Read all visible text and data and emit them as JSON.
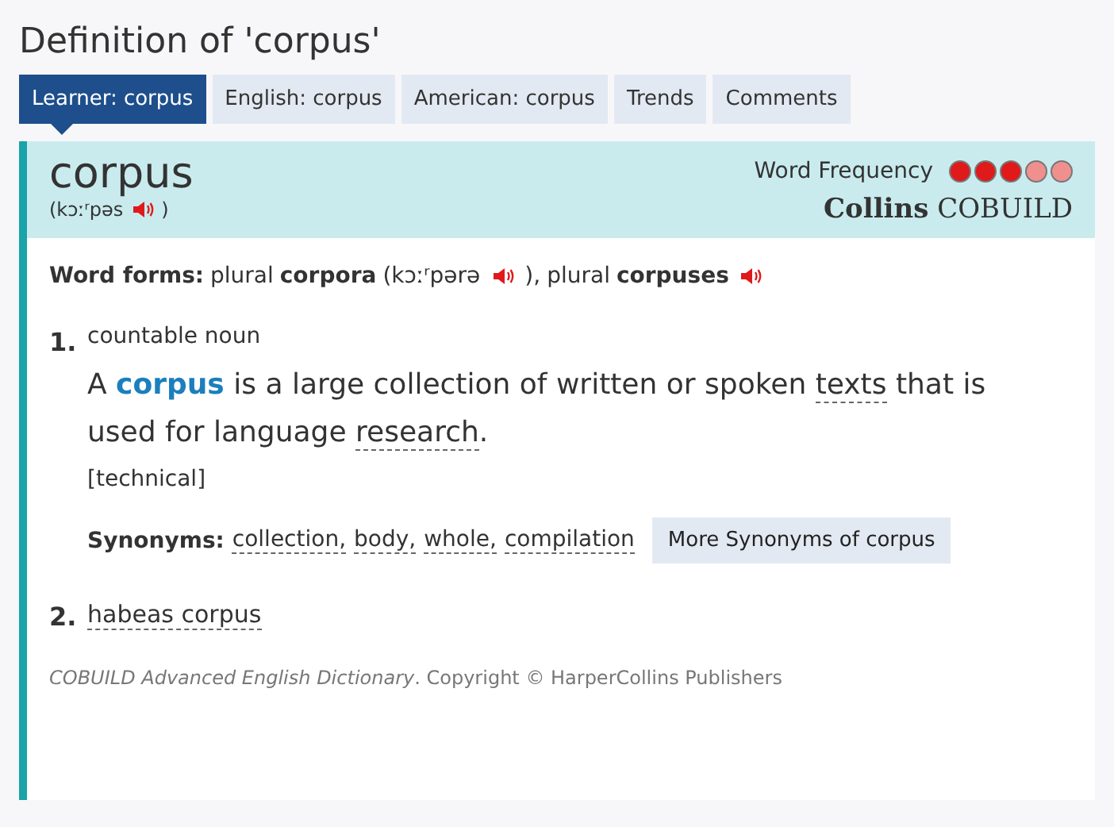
{
  "page_title": "Definition of 'corpus'",
  "tabs": [
    {
      "label": "Learner: corpus",
      "selected": true
    },
    {
      "label": "English: corpus",
      "selected": false
    },
    {
      "label": "American: corpus",
      "selected": false
    },
    {
      "label": "Trends",
      "selected": false
    },
    {
      "label": "Comments",
      "selected": false
    }
  ],
  "entry": {
    "headword": "corpus",
    "pronunciation": {
      "open": "(",
      "text": "kɔːʳpəs",
      "close": ")"
    },
    "frequency": {
      "label": "Word Frequency",
      "stars": 3
    },
    "brand": {
      "bold": "Collins",
      "rest": "COBUILD"
    },
    "word_forms": {
      "label": "Word forms:",
      "forms": [
        {
          "prefix": "plural",
          "word": "corpora",
          "pronunciation": "(kɔːʳpərə",
          "close": "),"
        },
        {
          "prefix": "plural",
          "word": "corpuses"
        }
      ]
    },
    "senses": [
      {
        "number": "1.",
        "kind": "definition",
        "grammar": "countable noun",
        "sentence": [
          {
            "kind": "plain",
            "text": "A "
          },
          {
            "kind": "headword",
            "text": "corpus"
          },
          {
            "kind": "plain",
            "text": " is a large collection of written or spoken "
          },
          {
            "kind": "link",
            "text": "texts"
          },
          {
            "kind": "plain",
            "text": " that is used for language "
          },
          {
            "kind": "link",
            "text": "research"
          },
          {
            "kind": "plain",
            "text": "."
          }
        ],
        "label": "[technical]",
        "synonyms": {
          "label": "Synonyms:",
          "words": [
            "collection,",
            "body,",
            "whole,",
            "compilation"
          ],
          "button": "More Synonyms of corpus"
        }
      },
      {
        "number": "2.",
        "kind": "link",
        "text": "habeas corpus"
      }
    ],
    "source": {
      "title": "COBUILD Advanced English Dictionary",
      "rest": ". Copyright © HarperCollins Publishers"
    }
  }
}
